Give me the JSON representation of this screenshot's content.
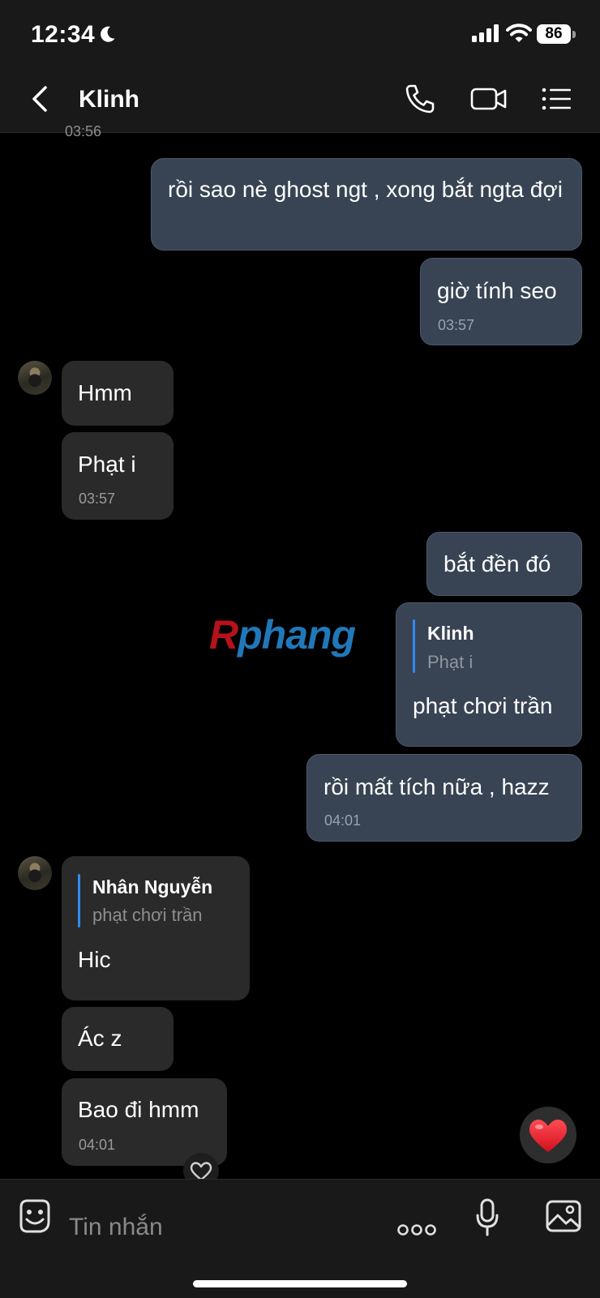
{
  "status_bar": {
    "time": "12:34",
    "battery": "86"
  },
  "header": {
    "contact_name": "Klinh"
  },
  "messages": {
    "top_timestamp": "03:56",
    "m1": {
      "text": "rồi sao nè ghost ngt , xong bắt ngta đợi"
    },
    "m2": {
      "text": "giờ tính seo",
      "time": "03:57"
    },
    "m3": {
      "text": "Hmm"
    },
    "m4": {
      "text": "Phạt i",
      "time": "03:57"
    },
    "m5": {
      "text": "bắt đền đó"
    },
    "m6": {
      "quote_name": "Klinh",
      "quote_text": "Phạt i",
      "text": "phạt chơi trần"
    },
    "m7": {
      "text": "rồi mất tích nữa , hazz",
      "time": "04:01"
    },
    "m8": {
      "quote_name": "Nhân Nguyễn",
      "quote_text": "phạt chơi trần",
      "text": "Hic"
    },
    "m9": {
      "text": "Ác z"
    },
    "m10": {
      "text": "Bao đi hmm",
      "time": "04:01"
    }
  },
  "watermark": {
    "first": "R",
    "rest": "phang"
  },
  "composer": {
    "placeholder": "Tin nhắn"
  },
  "colors": {
    "outgoing": "#384353",
    "incoming": "#2a2a2a",
    "quote_bar": "#2f8cf0",
    "heart": "#e8202f"
  }
}
